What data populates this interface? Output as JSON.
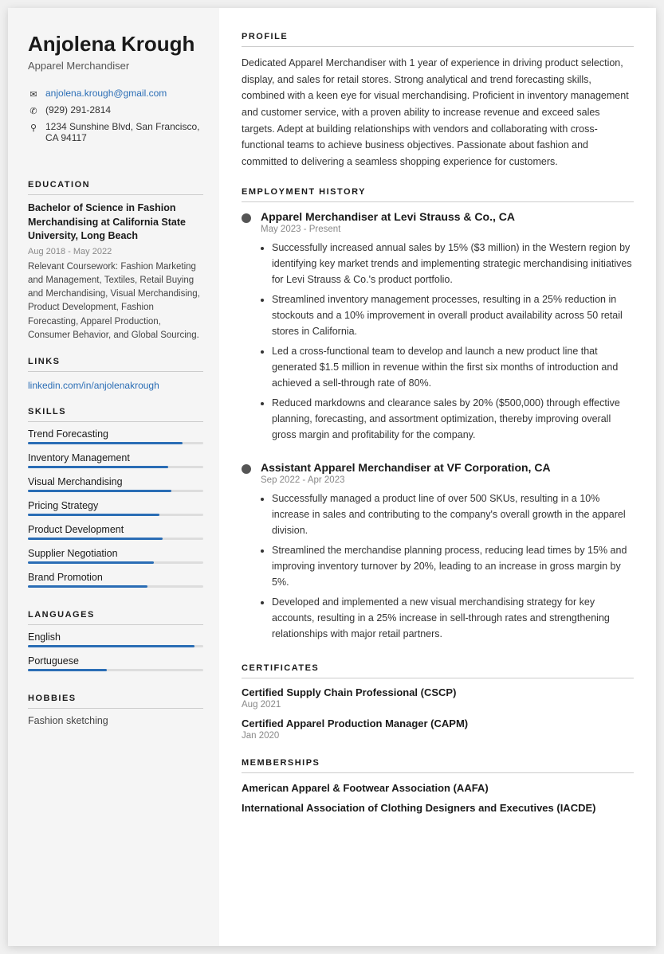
{
  "sidebar": {
    "name": "Anjolena Krough",
    "job_title": "Apparel Merchandiser",
    "contact": {
      "email": "anjolena.krough@gmail.com",
      "phone": "(929) 291-2814",
      "address": "1234 Sunshine Blvd, San Francisco, CA 94117"
    },
    "education": {
      "section_label": "Education",
      "degree": "Bachelor of Science in Fashion Merchandising at California State University, Long Beach",
      "dates": "Aug 2018 - May 2022",
      "coursework": "Relevant Coursework: Fashion Marketing and Management, Textiles, Retail Buying and Merchandising, Visual Merchandising, Product Development, Fashion Forecasting, Apparel Production, Consumer Behavior, and Global Sourcing."
    },
    "links": {
      "section_label": "Links",
      "linkedin": "linkedin.com/in/anjolenakrough",
      "linkedin_href": "#"
    },
    "skills": {
      "section_label": "Skills",
      "items": [
        {
          "label": "Trend Forecasting",
          "pct": 88
        },
        {
          "label": "Inventory Management",
          "pct": 80
        },
        {
          "label": "Visual Merchandising",
          "pct": 82
        },
        {
          "label": "Pricing Strategy",
          "pct": 75
        },
        {
          "label": "Product Development",
          "pct": 77
        },
        {
          "label": "Supplier Negotiation",
          "pct": 72
        },
        {
          "label": "Brand Promotion",
          "pct": 68
        }
      ]
    },
    "languages": {
      "section_label": "Languages",
      "items": [
        {
          "label": "English",
          "pct": 95
        },
        {
          "label": "Portuguese",
          "pct": 45
        }
      ]
    },
    "hobbies": {
      "section_label": "Hobbies",
      "items": [
        "Fashion sketching"
      ]
    }
  },
  "main": {
    "profile": {
      "section_label": "Profile",
      "text": "Dedicated Apparel Merchandiser with 1 year of experience in driving product selection, display, and sales for retail stores. Strong analytical and trend forecasting skills, combined with a keen eye for visual merchandising. Proficient in inventory management and customer service, with a proven ability to increase revenue and exceed sales targets. Adept at building relationships with vendors and collaborating with cross-functional teams to achieve business objectives. Passionate about fashion and committed to delivering a seamless shopping experience for customers."
    },
    "employment": {
      "section_label": "Employment History",
      "jobs": [
        {
          "title": "Apparel Merchandiser at Levi Strauss & Co., CA",
          "dates": "May 2023 - Present",
          "bullets": [
            "Successfully increased annual sales by 15% ($3 million) in the Western region by identifying key market trends and implementing strategic merchandising initiatives for Levi Strauss & Co.'s product portfolio.",
            "Streamlined inventory management processes, resulting in a 25% reduction in stockouts and a 10% improvement in overall product availability across 50 retail stores in California.",
            "Led a cross-functional team to develop and launch a new product line that generated $1.5 million in revenue within the first six months of introduction and achieved a sell-through rate of 80%.",
            "Reduced markdowns and clearance sales by 20% ($500,000) through effective planning, forecasting, and assortment optimization, thereby improving overall gross margin and profitability for the company."
          ]
        },
        {
          "title": "Assistant Apparel Merchandiser at VF Corporation, CA",
          "dates": "Sep 2022 - Apr 2023",
          "bullets": [
            "Successfully managed a product line of over 500 SKUs, resulting in a 10% increase in sales and contributing to the company's overall growth in the apparel division.",
            "Streamlined the merchandise planning process, reducing lead times by 15% and improving inventory turnover by 20%, leading to an increase in gross margin by 5%.",
            "Developed and implemented a new visual merchandising strategy for key accounts, resulting in a 25% increase in sell-through rates and strengthening relationships with major retail partners."
          ]
        }
      ]
    },
    "certificates": {
      "section_label": "Certificates",
      "items": [
        {
          "name": "Certified Supply Chain Professional (CSCP)",
          "date": "Aug 2021"
        },
        {
          "name": "Certified Apparel Production Manager (CAPM)",
          "date": "Jan 2020"
        }
      ]
    },
    "memberships": {
      "section_label": "Memberships",
      "items": [
        {
          "name": "American Apparel & Footwear Association (AAFA)"
        },
        {
          "name": "International Association of Clothing Designers and Executives (IACDE)"
        }
      ]
    }
  }
}
